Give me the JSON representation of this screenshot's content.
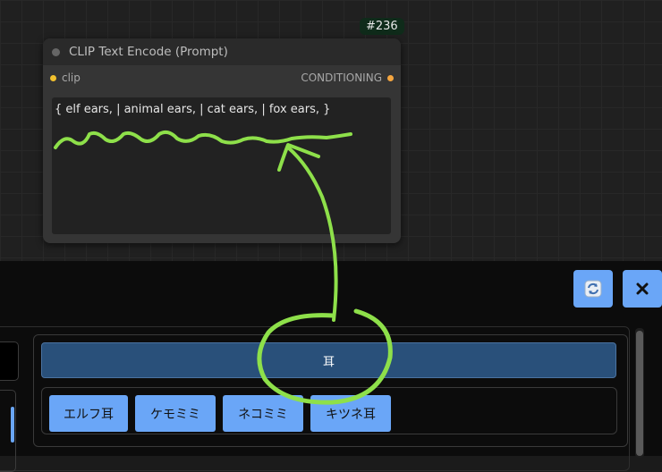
{
  "node": {
    "id_badge": "#236",
    "title": "CLIP Text Encode (Prompt)",
    "input_label": "clip",
    "output_label": "CONDITIONING",
    "prompt_text": "{ elf ears, | animal ears, | cat ears, | fox ears, }"
  },
  "panel": {
    "category_label": "耳",
    "tags": [
      {
        "label": "エルフ耳"
      },
      {
        "label": "ケモミミ"
      },
      {
        "label": "ネコミミ"
      },
      {
        "label": "キツネ耳"
      }
    ],
    "refresh_icon": "refresh-icon",
    "close_icon": "close-icon"
  },
  "colors": {
    "accent_blue": "#6aa6f7",
    "category_bg": "#29507a",
    "annotation_green": "#8ee04a",
    "input_slot": "#f2c12e",
    "output_slot": "#f5a640"
  }
}
